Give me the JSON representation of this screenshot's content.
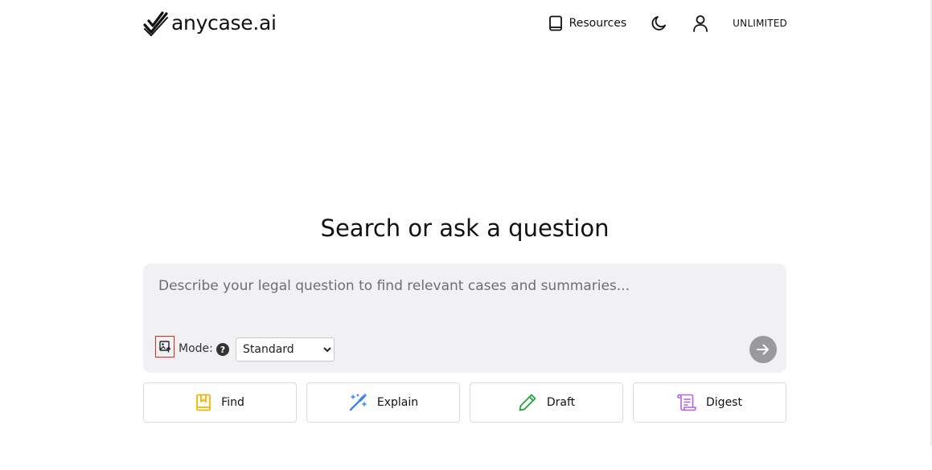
{
  "header": {
    "brand": "anycase.ai",
    "nav": {
      "resources_label": "Resources",
      "plan_badge": "UNLIMITED"
    },
    "icons": [
      "checks-logo-icon",
      "book-icon",
      "moon-icon",
      "user-icon"
    ]
  },
  "main": {
    "heading": "Search or ask a question",
    "search": {
      "placeholder": "Describe your legal question to find relevant cases and summaries...",
      "value": "",
      "mode_label": "Mode:",
      "help_glyph": "?",
      "mode_options": [
        "Standard"
      ],
      "mode_selected": "Standard"
    },
    "actions": [
      {
        "label": "Find",
        "icon": "bookmark-book-icon",
        "color": "#f0b800"
      },
      {
        "label": "Explain",
        "icon": "magic-wand-icon",
        "color": "#3b82f6"
      },
      {
        "label": "Draft",
        "icon": "pencil-icon",
        "color": "#22a33a"
      },
      {
        "label": "Digest",
        "icon": "scroll-icon",
        "color": "#b464d8"
      }
    ]
  },
  "colors": {
    "background": "#ffffff",
    "search_box": "#f1f1f3",
    "submit_button": "#9a9a9e",
    "highlight_border": "#e0281e"
  }
}
